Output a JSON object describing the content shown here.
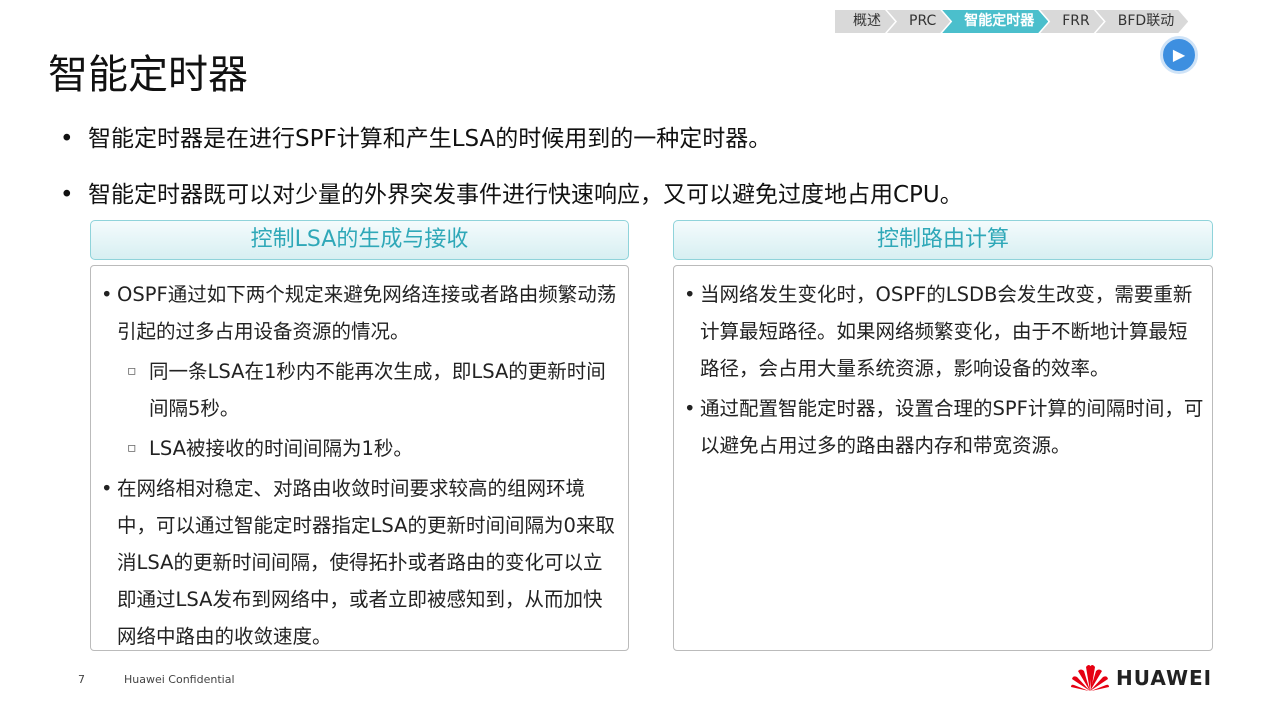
{
  "nav": {
    "steps": [
      "概述",
      "PRC",
      "智能定时器",
      "FRR",
      "BFD联动"
    ],
    "active": 2
  },
  "title": "智能定时器",
  "bullets": [
    "智能定时器是在进行SPF计算和产生LSA的时候用到的一种定时器。",
    "智能定时器既可以对少量的外界突发事件进行快速响应，又可以避免过度地占用CPU。"
  ],
  "left": {
    "header": "控制LSA的生成与接收",
    "items": [
      {
        "type": "b",
        "text": "OSPF通过如下两个规定来避免网络连接或者路由频繁动荡引起的过多占用设备资源的情况。"
      },
      {
        "type": "s",
        "text": "同一条LSA在1秒内不能再次生成，即LSA的更新时间间隔5秒。"
      },
      {
        "type": "s",
        "text": "LSA被接收的时间间隔为1秒。"
      },
      {
        "type": "b",
        "text": "在网络相对稳定、对路由收敛时间要求较高的组网环境中，可以通过智能定时器指定LSA的更新时间间隔为0来取消LSA的更新时间间隔，使得拓扑或者路由的变化可以立即通过LSA发布到网络中，或者立即被感知到，从而加快网络中路由的收敛速度。"
      }
    ]
  },
  "right": {
    "header": "控制路由计算",
    "items": [
      {
        "type": "b",
        "text": "当网络发生变化时，OSPF的LSDB会发生改变，需要重新计算最短路径。如果网络频繁变化，由于不断地计算最短路径，会占用大量系统资源，影响设备的效率。"
      },
      {
        "type": "b",
        "text": "通过配置智能定时器，设置合理的SPF计算的间隔时间，可以避免占用过多的路由器内存和带宽资源。"
      }
    ]
  },
  "footer": {
    "page": "7",
    "confidential": "Huawei Confidential",
    "logo": "HUAWEI"
  },
  "colors": {
    "accent": "#4bbfcc",
    "header_text": "#2fa8b8"
  }
}
